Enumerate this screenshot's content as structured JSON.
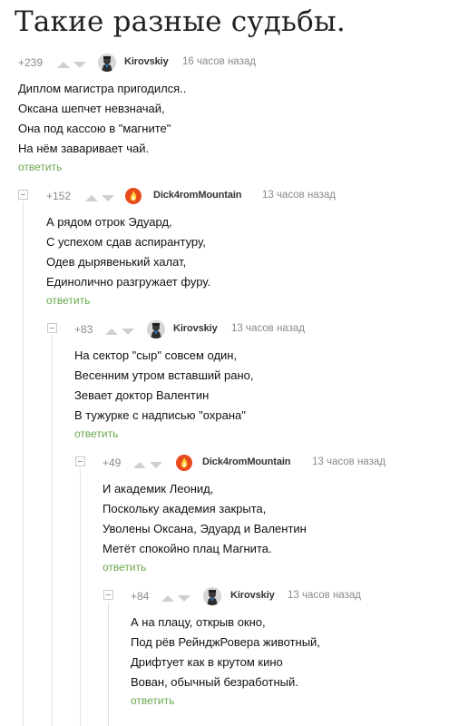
{
  "post": {
    "title": "Такие разные судьбы."
  },
  "comments": [
    {
      "rating": "+239",
      "author": "Kirovskiy",
      "time": "16 часов назад",
      "lines": [
        "Диплом магистра пригодился..",
        "Оксана шепчет невзначай,",
        "Она под кассою в \"магните\"",
        "На нём заваривает чай."
      ],
      "reply": "ответить",
      "avatar": "kirovskiy-avatar"
    },
    {
      "rating": "+152",
      "author": "Dick4romMountain",
      "time": "13 часов назад",
      "lines": [
        "А рядом отрок Эдуард,",
        "С успехом сдав аспирантуру,",
        "Одев дырявенький халат,",
        "Единолично разгружает фуру."
      ],
      "reply": "ответить",
      "avatar": "dick4rom-avatar"
    },
    {
      "rating": "+83",
      "author": "Kirovskiy",
      "time": "13 часов назад",
      "lines": [
        "На сектор \"сыр\" совсем один,",
        "Весенним утром вставший рано,",
        "Зевает доктор Валентин",
        "В тужурке с надписью \"охрана\""
      ],
      "reply": "ответить",
      "avatar": "kirovskiy-avatar"
    },
    {
      "rating": "+49",
      "author": "Dick4romMountain",
      "time": "13 часов назад",
      "lines": [
        "И академик Леонид,",
        "Поскольку академия закрыта,",
        "Уволены Оксана, Эдуард и Валентин",
        "Метёт спокойно плац Магнита."
      ],
      "reply": "ответить",
      "avatar": "dick4rom-avatar"
    },
    {
      "rating": "+84",
      "author": "Kirovskiy",
      "time": "13 часов назад",
      "lines": [
        "А на плацу, открыв окно,",
        "Под рёв РейнджРовера животный,",
        "Дрифтует как в крутом кино",
        "Вован, обычный безработный."
      ],
      "reply": "ответить",
      "avatar": "kirovskiy-avatar"
    }
  ]
}
